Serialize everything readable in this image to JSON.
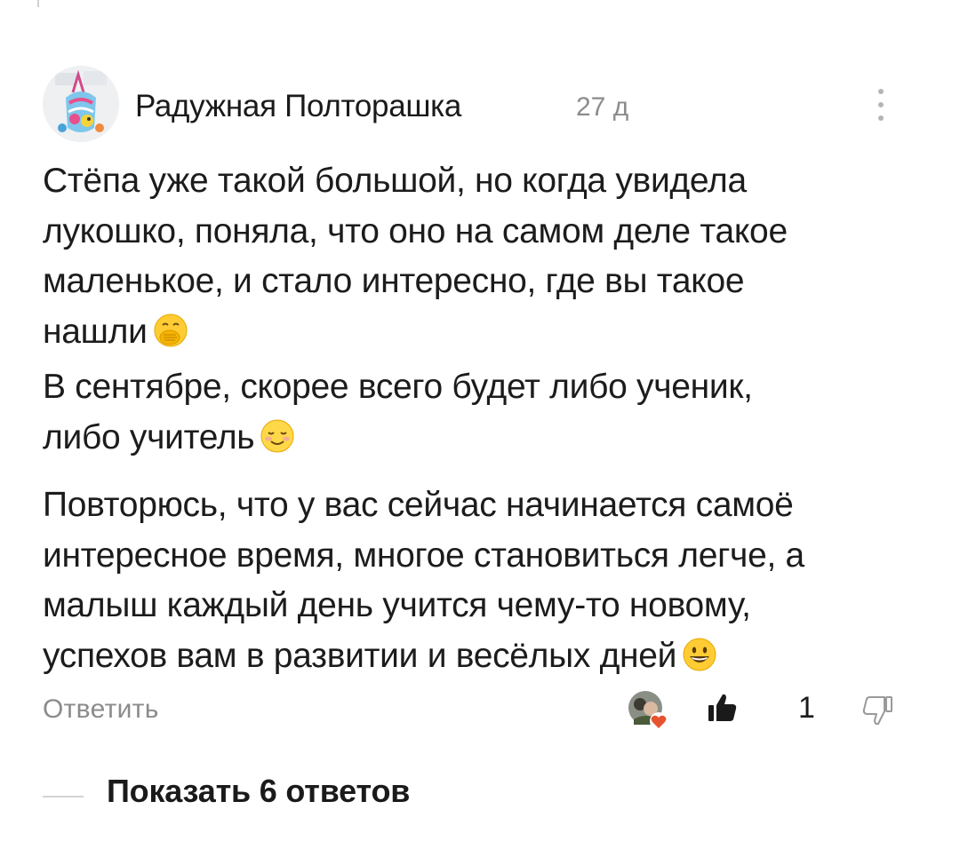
{
  "comment": {
    "author": "Радужная Полторашка",
    "time_ago": "27 д",
    "paragraphs": [
      {
        "lines": [
          {
            "text": "Стёпа уже такой большой, но когда увидела"
          },
          {
            "text": "лукошко, поняла, что оно на самом деле такое"
          },
          {
            "text": "маленькое, и стало интересно, где вы такое"
          },
          {
            "text": "нашли",
            "emoji": "hand-over-mouth-emoji"
          },
          {
            "text": "В сентябре, скорее всего будет либо ученик,"
          },
          {
            "text": "либо учитель",
            "emoji": "smiling-blush-emoji"
          }
        ]
      },
      {
        "lines": [
          {
            "text": "Повторюсь, что у вас сейчас начинается самоё"
          },
          {
            "text": "интересное время, многое становиться легче, а"
          },
          {
            "text": "малыш каждый день учится чему-то новому,"
          },
          {
            "text": "успехов вам в развитии и весёлых дней",
            "emoji": "grinning-face-emoji"
          }
        ]
      }
    ]
  },
  "actions": {
    "reply_label": "Ответить",
    "like_count": "1"
  },
  "replies": {
    "show_label": "Показать 6 ответов"
  },
  "colors": {
    "text": "#1a1a1a",
    "muted": "#8c8c8c",
    "emoji_yellow": "#ffcc33",
    "heart": "#e8532f"
  }
}
